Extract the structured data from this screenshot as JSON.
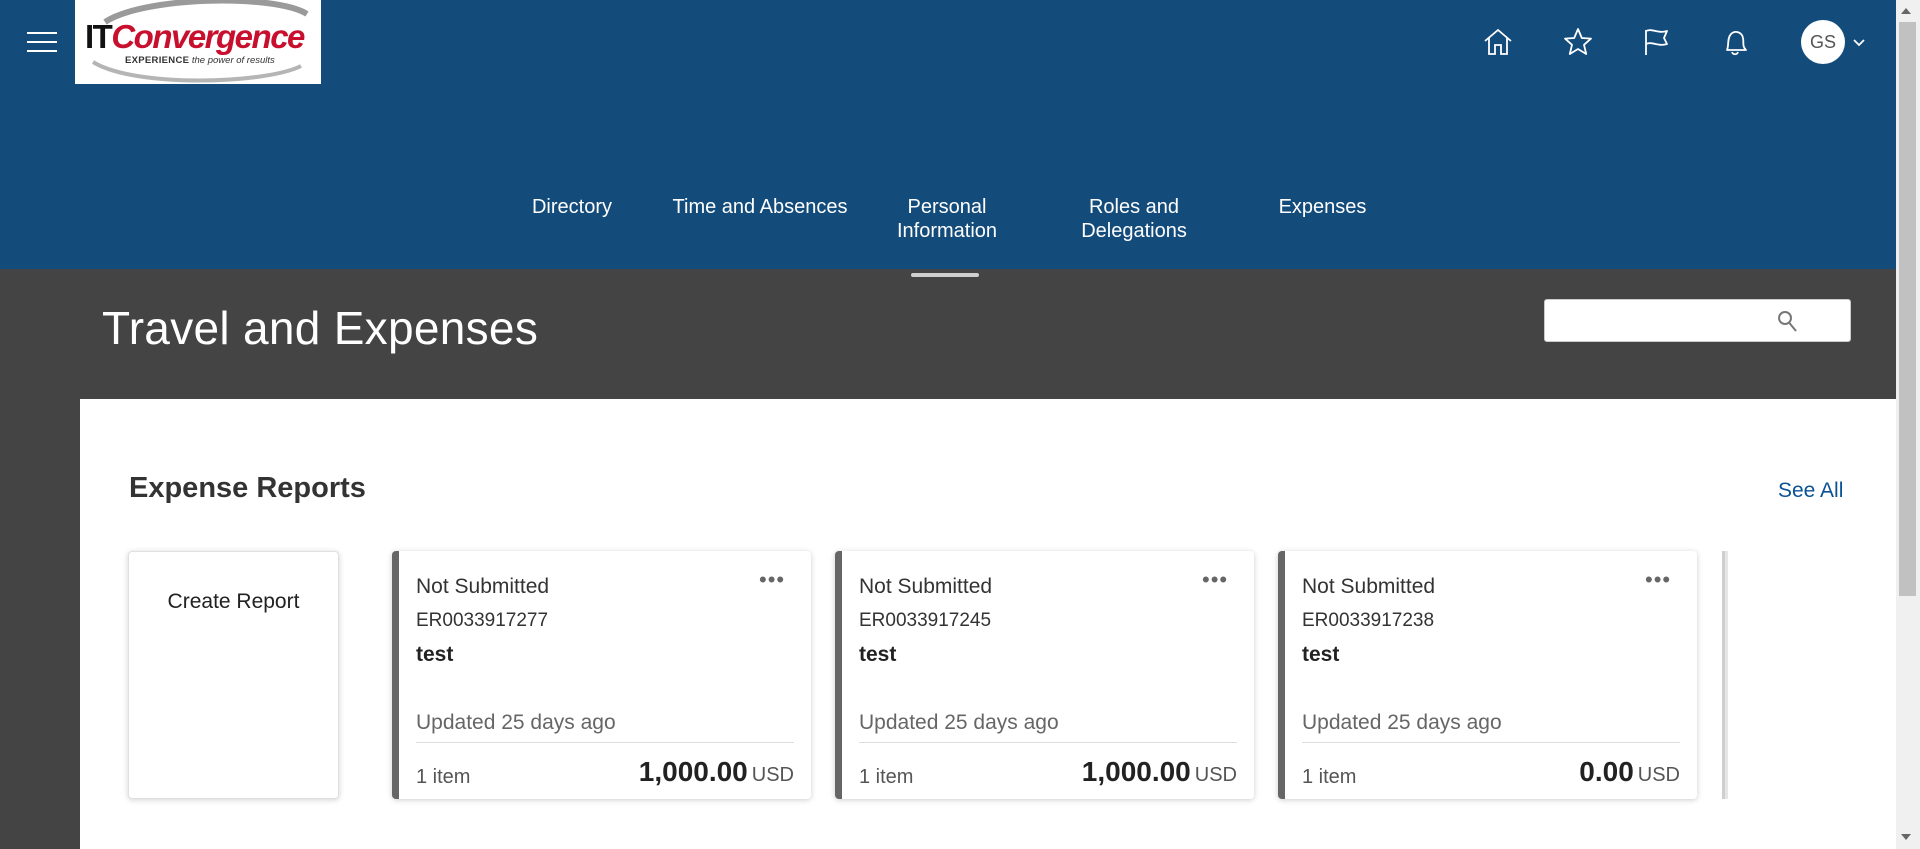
{
  "header": {
    "logo": {
      "brand_it": "IT",
      "brand_rest": "Convergence",
      "tagline_bold": "EXPERIENCE",
      "tagline_rest": " the power of results"
    },
    "icons": [
      "home-icon",
      "star-icon",
      "flag-icon",
      "bell-icon"
    ],
    "user_initials": "GS"
  },
  "nav": {
    "items": [
      {
        "label": "Directory"
      },
      {
        "label": "Time and Absences"
      },
      {
        "label": "Personal Information"
      },
      {
        "label": "Roles and Delegations"
      },
      {
        "label": "Expenses"
      }
    ],
    "selected_index": 2
  },
  "page": {
    "title": "Travel and Expenses",
    "search": {
      "value": "",
      "placeholder": ""
    }
  },
  "expense_reports": {
    "title": "Expense Reports",
    "see_all": "See All",
    "create_label": "Create Report",
    "cards": [
      {
        "status": "Not Submitted",
        "number": "ER0033917277",
        "name": "test",
        "updated": "Updated 25 days ago",
        "items": "1 item",
        "amount": "1,000.00",
        "currency": "USD"
      },
      {
        "status": "Not Submitted",
        "number": "ER0033917245",
        "name": "test",
        "updated": "Updated 25 days ago",
        "items": "1 item",
        "amount": "1,000.00",
        "currency": "USD"
      },
      {
        "status": "Not Submitted",
        "number": "ER0033917238",
        "name": "test",
        "updated": "Updated 25 days ago",
        "items": "1 item",
        "amount": "0.00",
        "currency": "USD"
      }
    ]
  },
  "colors": {
    "header_bg": "#134b7b",
    "band_bg": "#444444",
    "link": "#0a5295",
    "card_accent": "#666666"
  }
}
